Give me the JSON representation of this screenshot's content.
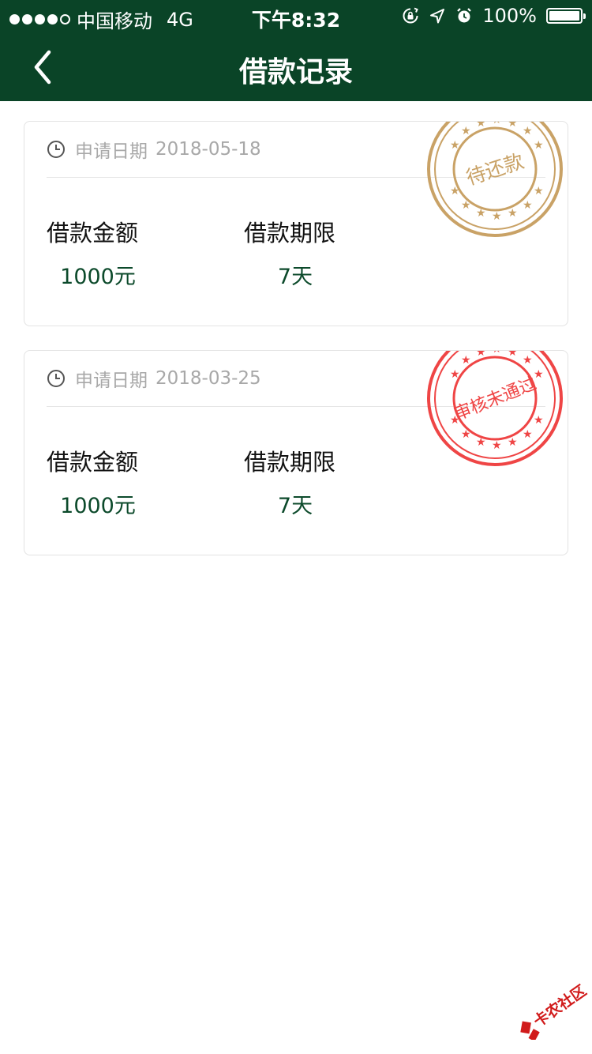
{
  "status_bar": {
    "carrier": "中国移动",
    "network": "4G",
    "time": "下午8:32",
    "battery": "100%"
  },
  "nav": {
    "title": "借款记录",
    "back_icon": "chevron-left-icon"
  },
  "records": [
    {
      "date_label": "申请日期",
      "date": "2018-05-18",
      "amount_label": "借款金额",
      "amount": "1000元",
      "term_label": "借款期限",
      "term": "7天",
      "stamp_text": "待还款",
      "stamp_color": "#c9a266"
    },
    {
      "date_label": "申请日期",
      "date": "2018-03-25",
      "amount_label": "借款金额",
      "amount": "1000元",
      "term_label": "借款期限",
      "term": "7天",
      "stamp_text": "审核未通过",
      "stamp_color": "#ef4545"
    }
  ],
  "watermark": {
    "text": "卡农社区"
  },
  "colors": {
    "header_bg": "#0a4427",
    "value_green": "#0c4a2b",
    "muted_gray": "#a8a8a8"
  }
}
